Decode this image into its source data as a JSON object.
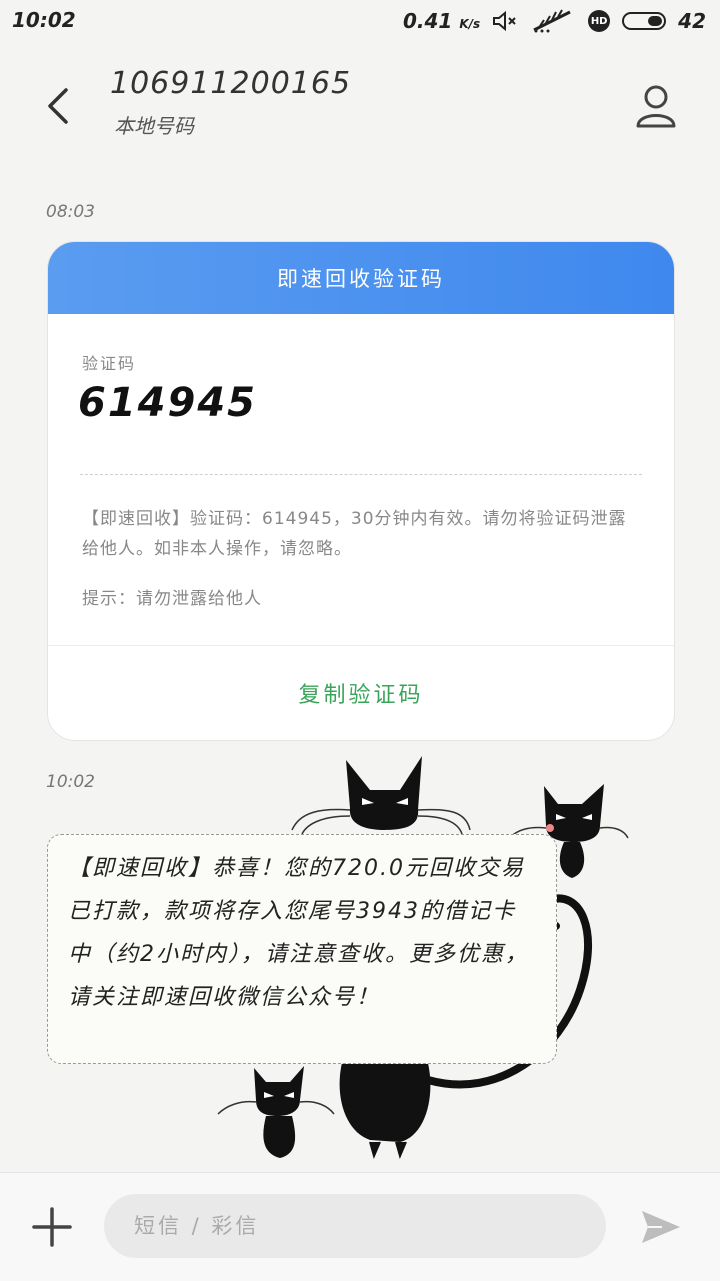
{
  "status_bar": {
    "time": "10:02",
    "net_speed": "0.41",
    "net_unit": "K/s",
    "battery": "42",
    "hd_badge": "HD"
  },
  "header": {
    "sender": "106911200165",
    "subtitle": "本地号码"
  },
  "messages": [
    {
      "timestamp": "08:03",
      "card": {
        "title": "即速回收验证码",
        "code_label": "验证码",
        "code_value": "614945",
        "body": "【即速回收】验证码：614945，30分钟内有效。请勿将验证码泄露给他人。如非本人操作，请忽略。",
        "hint": "提示：请勿泄露给他人",
        "copy_label": "复制验证码"
      }
    },
    {
      "timestamp": "10:02",
      "text": "【即速回收】恭喜！您的720.0元回收交易已打款，款项将存入您尾号3943的借记卡中（约2小时内），请注意查收。更多优惠，请关注即速回收微信公众号！"
    }
  ],
  "composer": {
    "placeholder": "短信 / 彩信"
  },
  "colors": {
    "card_header": "#4a90ee",
    "copy_button": "#3aa55a"
  }
}
